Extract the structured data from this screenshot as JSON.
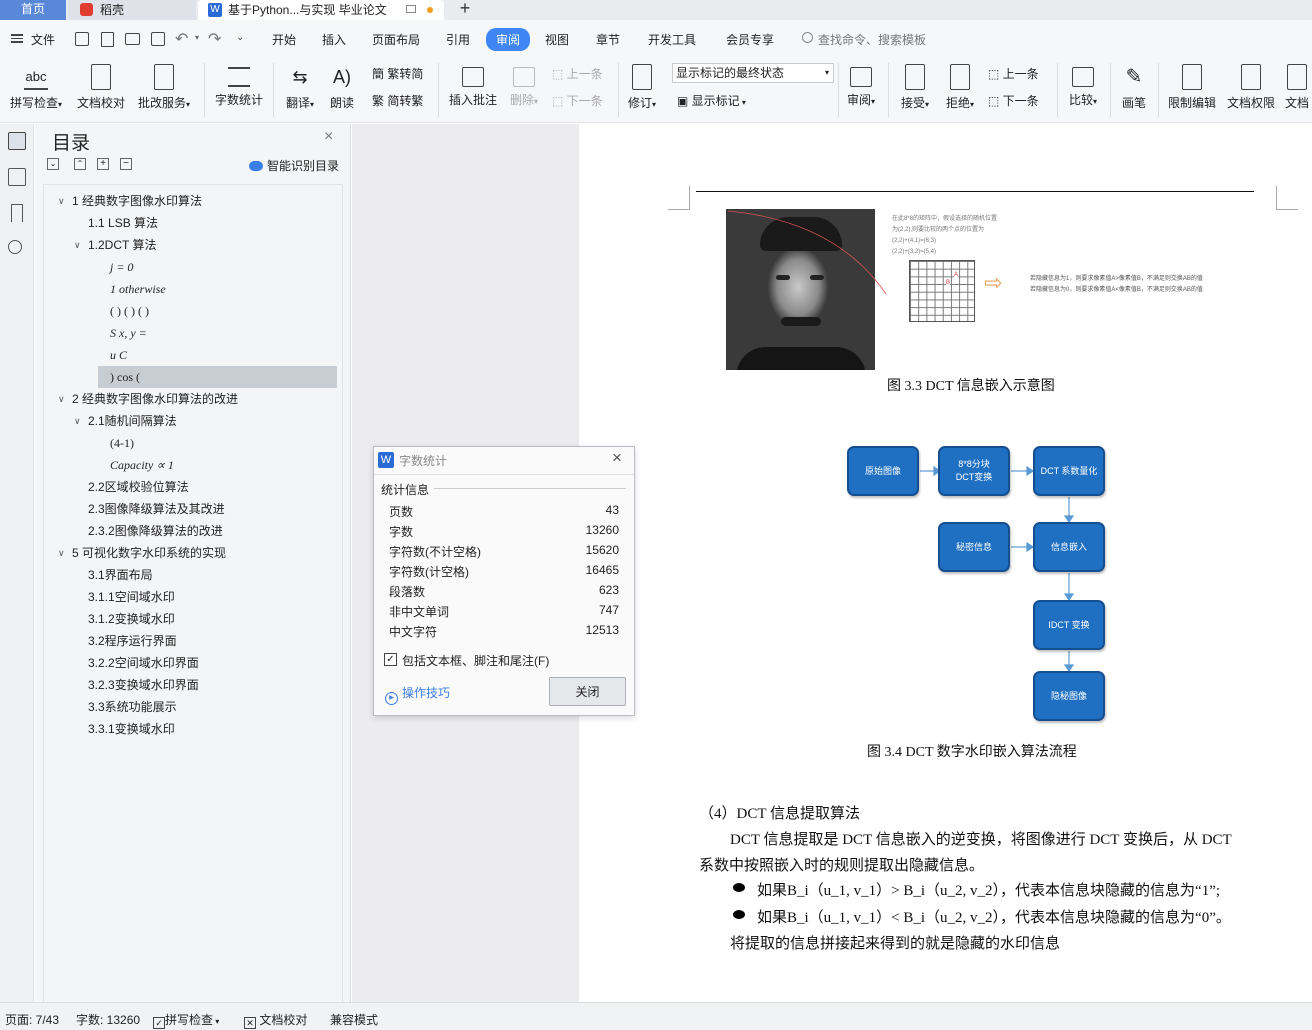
{
  "tabs": {
    "home": "首页",
    "daoke": "稻壳",
    "doc": "基于Python...与实现 毕业论文",
    "add": "+"
  },
  "menu": {
    "file": "文件",
    "items": [
      "开始",
      "插入",
      "页面布局",
      "引用",
      "审阅",
      "视图",
      "章节",
      "开发工具",
      "会员专享"
    ],
    "active": "审阅",
    "search": "查找命令、搜索模板"
  },
  "ribbon": {
    "spell": "拼写检查",
    "doccheck": "文档校对",
    "batch": "批改服务",
    "wordcount": "字数统计",
    "translate": "翻译",
    "read": "朗读",
    "trad": "繁转简",
    "simp": "简转繁",
    "insert_comment": "插入批注",
    "delete": "删除",
    "prev_comment": "上一条",
    "next_comment": "下一条",
    "track": "修订",
    "track_state": "显示标记的最终状态",
    "show_marks": "显示标记",
    "review": "审阅",
    "accept": "接受",
    "reject": "拒绝",
    "prev": "上一条",
    "next": "下一条",
    "compare": "比较",
    "pen": "画笔",
    "restrict": "限制编辑",
    "docperm": "文档权限",
    "docmore": "文档"
  },
  "nav": {
    "title": "目录",
    "smart": "智能识别目录"
  },
  "toc": [
    {
      "label": "1 经典数字图像水印算法",
      "level": 0,
      "arrow": "∨"
    },
    {
      "label": "1.1 LSB 算法",
      "level": 1,
      "arrow": ""
    },
    {
      "label": "1.2DCT 算法",
      "level": 1,
      "arrow": "∨"
    },
    {
      "label": "j = 0",
      "level": 2,
      "arrow": "",
      "italic": true
    },
    {
      "label": "1 otherwise",
      "level": 2,
      "arrow": "",
      "italic": true
    },
    {
      "label": "( ) ( ) ( )",
      "level": 2,
      "arrow": ""
    },
    {
      "label": "S x, y =",
      "level": 2,
      "arrow": "",
      "italic": true
    },
    {
      "label": "u C",
      "level": 2,
      "arrow": "",
      "italic": true
    },
    {
      "label": ") cos (",
      "level": 2,
      "arrow": "",
      "selected": true
    },
    {
      "label": "2 经典数字图像水印算法的改进",
      "level": 0,
      "arrow": "∨"
    },
    {
      "label": "2.1随机间隔算法",
      "level": 1,
      "arrow": "∨"
    },
    {
      "label": "(4-1)",
      "level": 2,
      "arrow": ""
    },
    {
      "label": "Capacity ∝ 1",
      "level": 2,
      "arrow": "",
      "italic": true
    },
    {
      "label": "2.2区域校验位算法",
      "level": 1,
      "arrow": ""
    },
    {
      "label": "2.3图像降级算法及其改进",
      "level": 1,
      "arrow": ""
    },
    {
      "label": "2.3.2图像降级算法的改进",
      "level": 1,
      "arrow": ""
    },
    {
      "label": "5 可视化数字水印系统的实现",
      "level": 0,
      "arrow": "∨"
    },
    {
      "label": "3.1界面布局",
      "level": 1,
      "arrow": ""
    },
    {
      "label": "3.1.1空间域水印",
      "level": 1,
      "arrow": ""
    },
    {
      "label": "3.1.2变换域水印",
      "level": 1,
      "arrow": ""
    },
    {
      "label": "3.2程序运行界面",
      "level": 1,
      "arrow": ""
    },
    {
      "label": "3.2.2空间域水印界面",
      "level": 1,
      "arrow": ""
    },
    {
      "label": "3.2.3变换域水印界面",
      "level": 1,
      "arrow": ""
    },
    {
      "label": "3.3系统功能展示",
      "level": 1,
      "arrow": ""
    },
    {
      "label": "3.3.1变换域水印",
      "level": 1,
      "arrow": ""
    }
  ],
  "dialog": {
    "title": "字数统计",
    "section": "统计信息",
    "rows": [
      {
        "k": "页数",
        "v": "43"
      },
      {
        "k": "字数",
        "v": "13260"
      },
      {
        "k": "字符数(不计空格)",
        "v": "15620"
      },
      {
        "k": "字符数(计空格)",
        "v": "16465"
      },
      {
        "k": "段落数",
        "v": "623"
      },
      {
        "k": "非中文单词",
        "v": "747"
      },
      {
        "k": "中文字符",
        "v": "12513"
      }
    ],
    "checkbox": "包括文本框、脚注和尾注(F)",
    "tips": "操作技巧",
    "close": "关闭"
  },
  "doc": {
    "fig33_notes": [
      "在此8*8的矩阵中，假设选择的随机位置",
      "为(2,2),则要比较的两个点的位置为",
      "(2,2)+(4,1)=(6,3)",
      "(2,2)+(3,2)=(5,4)"
    ],
    "fig33_rules": [
      "若隐藏信息为1，则要求像素值A>像素值B，不满足则交换AB的值",
      "若隐藏信息为0，则要求像素值A<像素值B，不满足则交换AB的值"
    ],
    "fig33_cap": "图 3.3   DCT 信息嵌入示意图",
    "flow": {
      "orig": "原始图像",
      "block": "8*8分块\nDCT变换",
      "quant": "DCT 系数量化",
      "secret": "秘密信息",
      "embed": "信息嵌入",
      "idct": "IDCT 变换",
      "hidden": "隐秘图像"
    },
    "fig34_cap": "图 3.4   DCT 数字水印嵌入算法流程",
    "h4": "（4）DCT 信息提取算法",
    "p1": "DCT 信息提取是 DCT 信息嵌入的逆变换，将图像进行 DCT 变换后，从 DCT",
    "p2": "系数中按照嵌入时的规则提取出隐藏信息。",
    "b1": "如果B_i（u_1, v_1）> B_i（u_2, v_2），代表本信息块隐藏的信息为“1”;",
    "b2": "如果B_i（u_1, v_1）< B_i（u_2, v_2），代表本信息块隐藏的信息为“0”。",
    "p3": "将提取的信息拼接起来得到的就是隐藏的水印信息"
  },
  "status": {
    "page": "页面: 7/43",
    "words": "字数: 13260",
    "spell": "拼写检查",
    "doccheck": "文档校对",
    "compat": "兼容模式"
  }
}
